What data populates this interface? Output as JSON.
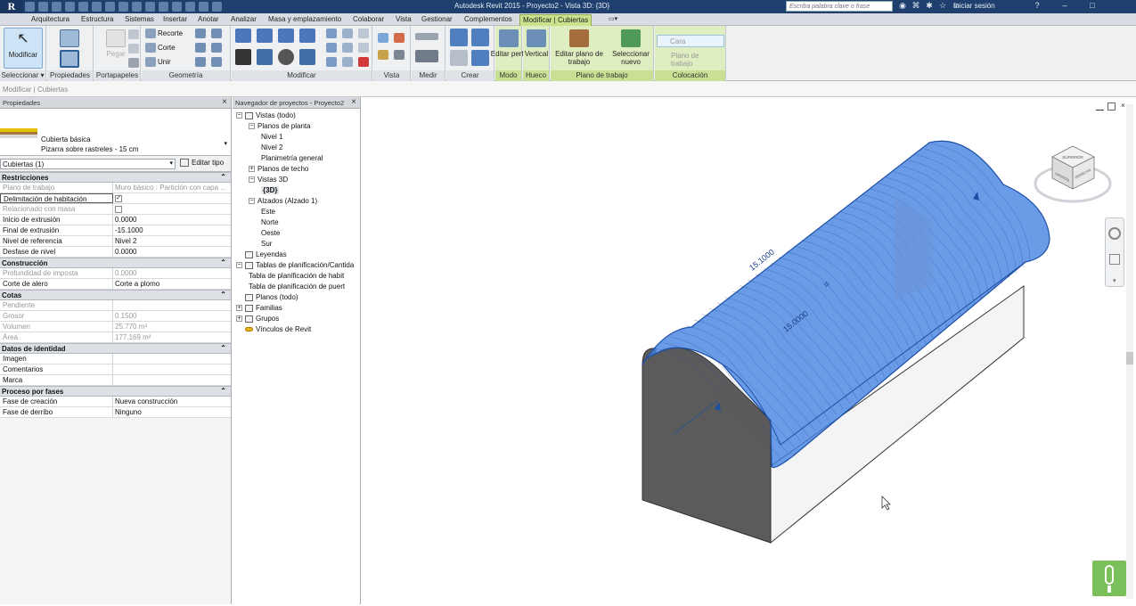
{
  "app": {
    "logo": "R",
    "title": "Autodesk Revit 2015 -    Proyecto2 - Vista 3D: {3D}",
    "search_placeholder": "Escriba palabra clave o frase",
    "login": "Iniciar sesión"
  },
  "menu": [
    {
      "label": "Arquitectura",
      "active": false
    },
    {
      "label": "Estructura",
      "active": false
    },
    {
      "label": "Sistemas",
      "active": false
    },
    {
      "label": "Insertar",
      "active": false
    },
    {
      "label": "Anotar",
      "active": false
    },
    {
      "label": "Analizar",
      "active": false
    },
    {
      "label": "Masa y emplazamiento",
      "active": false
    },
    {
      "label": "Colaborar",
      "active": false
    },
    {
      "label": "Vista",
      "active": false
    },
    {
      "label": "Gestionar",
      "active": false
    },
    {
      "label": "Complementos",
      "active": false
    },
    {
      "label": "Modificar | Cubiertas",
      "active": true
    }
  ],
  "ribbon": {
    "panels": [
      "Seleccionar",
      "Propiedades",
      "Portapapeles",
      "Geometría",
      "Modificar",
      "Vista",
      "Medir",
      "Crear",
      "Modo",
      "Hueco",
      "Plano de trabajo",
      "Colocación"
    ],
    "modificar": "Modificar",
    "pegar": "Pegar",
    "geometry": {
      "recorte": "Recorte",
      "corte": "Corte",
      "unir": "Unir"
    },
    "editar_perfil": "Editar perfil",
    "vertical": "Vertical",
    "editar_plano": "Editar plano de trabajo",
    "seleccionar_nuevo": "Seleccionar nuevo",
    "cara": "Cara",
    "plano_trabajo": "Plano de trabajo",
    "seleccionar_dd": "Seleccionar ▾"
  },
  "options_bar": "Modificar | Cubiertas",
  "properties": {
    "title": "Propiedades",
    "type_name": "Cubierta básica",
    "type_sub": "Pizarra sobre rastreles - 15 cm",
    "instance": "Cubiertas (1)",
    "edit_type": "Editar tipo",
    "groups": [
      {
        "name": "Restricciones",
        "rows": [
          {
            "k": "Plano de trabajo",
            "v": "Muro básico : Partición con capa ...",
            "dim": true
          },
          {
            "k": "Delimitación de habitación",
            "v": "✓",
            "check": true,
            "selected": true
          },
          {
            "k": "Relacionado con masa",
            "v": "",
            "check": true,
            "dim": true
          },
          {
            "k": "Inicio de extrusión",
            "v": "0.0000"
          },
          {
            "k": "Final de extrusión",
            "v": "-15.1000"
          },
          {
            "k": "Nivel de referencia",
            "v": "Nivel 2"
          },
          {
            "k": "Desfase de nivel",
            "v": "0.0000"
          }
        ]
      },
      {
        "name": "Construcción",
        "rows": [
          {
            "k": "Profundidad de imposta",
            "v": "0.0000",
            "dim": true
          },
          {
            "k": "Corte de alero",
            "v": "Corte a plomo"
          }
        ]
      },
      {
        "name": "Cotas",
        "rows": [
          {
            "k": "Pendiente",
            "v": "",
            "dim": true
          },
          {
            "k": "Grosor",
            "v": "0.1500",
            "dim": true
          },
          {
            "k": "Volumen",
            "v": "25.770 m³",
            "dim": true
          },
          {
            "k": "Área",
            "v": "177.169 m²",
            "dim": true
          }
        ]
      },
      {
        "name": "Datos de identidad",
        "rows": [
          {
            "k": "Imagen",
            "v": ""
          },
          {
            "k": "Comentarios",
            "v": ""
          },
          {
            "k": "Marca",
            "v": ""
          }
        ]
      },
      {
        "name": "Proceso por fases",
        "rows": [
          {
            "k": "Fase de creación",
            "v": "Nueva construcción"
          },
          {
            "k": "Fase de derribo",
            "v": "Ninguno"
          }
        ]
      }
    ]
  },
  "navigator": {
    "title": "Navegador de proyectos - Proyecto2",
    "items": [
      {
        "label": "Vistas (todo)",
        "level": 0,
        "toggle": "−",
        "icon": "views-icon"
      },
      {
        "label": "Planos de planta",
        "level": 1,
        "toggle": "−"
      },
      {
        "label": "Nivel 1",
        "level": 2
      },
      {
        "label": "Nivel 2",
        "level": 2
      },
      {
        "label": "Planimetría general",
        "level": 2
      },
      {
        "label": "Planos de techo",
        "level": 1,
        "toggle": "+"
      },
      {
        "label": "Vistas 3D",
        "level": 1,
        "toggle": "−"
      },
      {
        "label": "{3D}",
        "level": 2,
        "bold": true
      },
      {
        "label": "Alzados (Alzado 1)",
        "level": 1,
        "toggle": "−"
      },
      {
        "label": "Este",
        "level": 2
      },
      {
        "label": "Norte",
        "level": 2
      },
      {
        "label": "Oeste",
        "level": 2
      },
      {
        "label": "Sur",
        "level": 2
      },
      {
        "label": "Leyendas",
        "level": 0,
        "icon": "legend-icon"
      },
      {
        "label": "Tablas de planificación/Cantida",
        "level": 0,
        "toggle": "−",
        "icon": "table-icon"
      },
      {
        "label": "Tabla de planificación de habit",
        "level": 1
      },
      {
        "label": "Tabla de planificación de puert",
        "level": 1
      },
      {
        "label": "Planos (todo)",
        "level": 0,
        "icon": "sheets-icon"
      },
      {
        "label": "Familias",
        "level": 0,
        "toggle": "+",
        "icon": "families-icon"
      },
      {
        "label": "Grupos",
        "level": 0,
        "toggle": "+",
        "icon": "groups-icon"
      },
      {
        "label": "Vínculos de Revit",
        "level": 0,
        "icon": "links-icon"
      }
    ]
  },
  "view": {
    "dim1": "15.1000",
    "dim2": "15.0000",
    "cube": {
      "top": "SUPERIOR",
      "front": "FRONTAL",
      "right": "DERECHA"
    }
  },
  "colors": {
    "titlebar": "#1f3f6e",
    "ribbon_active": "#c9e28c",
    "roof": "#3f7fe0",
    "wall_dark": "#5b5b5b"
  }
}
